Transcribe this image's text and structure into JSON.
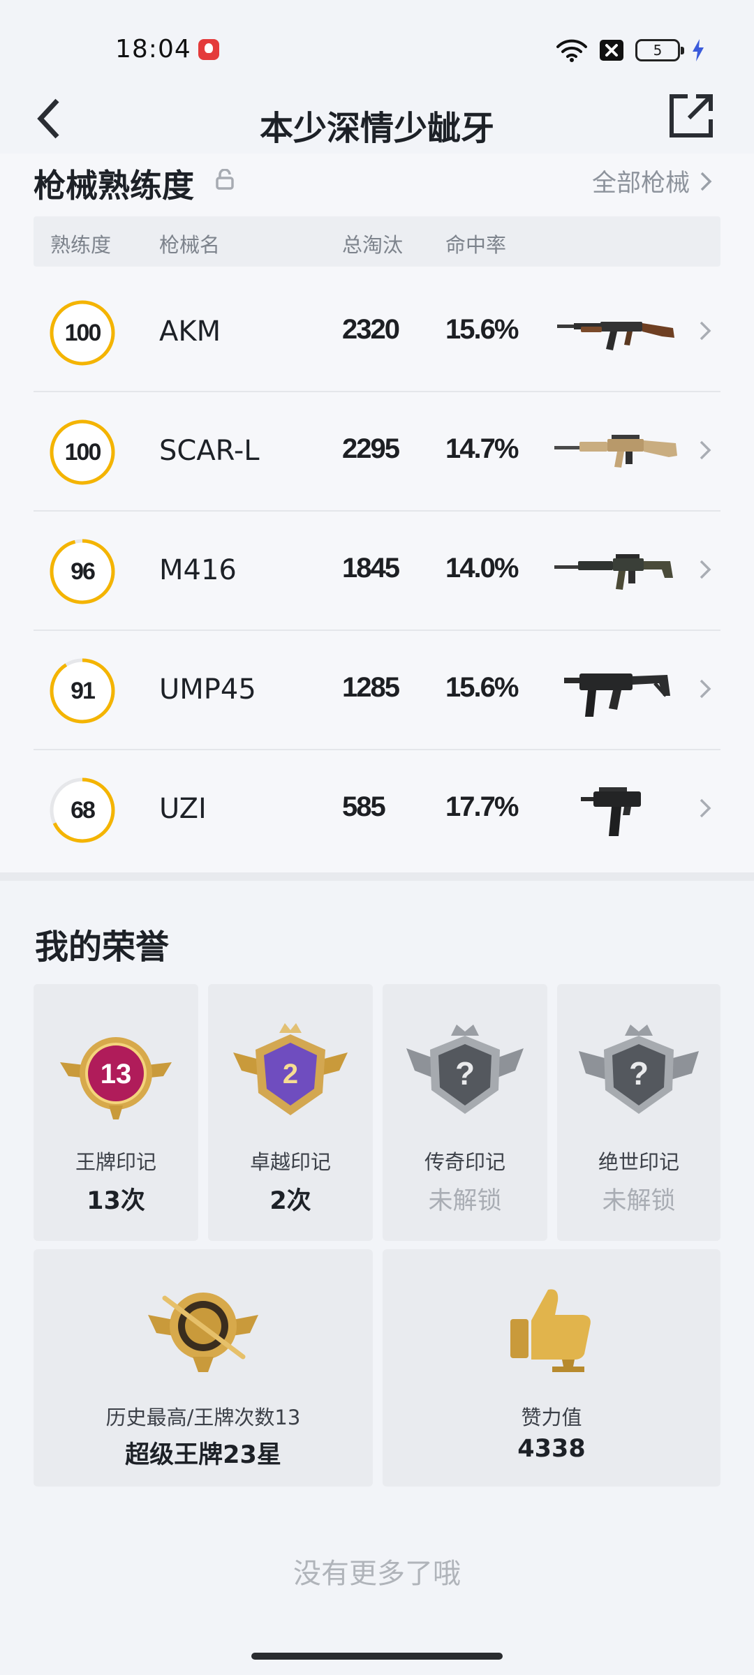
{
  "status_bar": {
    "time": "18:04",
    "battery_level": "5",
    "icons": [
      "app-badge-icon",
      "wifi-icon",
      "notification-x-icon",
      "battery-icon",
      "charging-bolt-icon"
    ]
  },
  "header": {
    "title": "本少深情少龇牙",
    "back_icon": "chevron-left-icon",
    "share_icon": "share-external-icon"
  },
  "weapon_section": {
    "title": "枪械熟练度",
    "all_link": "全部枪械",
    "columns": [
      "熟练度",
      "枪械名",
      "总淘汰",
      "命中率"
    ],
    "ring_color": "#f4b400",
    "weapons": [
      {
        "proficiency": "100",
        "progress": 1.0,
        "name": "AKM",
        "kills": "2320",
        "hit_rate": "15.6%",
        "icon": "akm-rifle-icon"
      },
      {
        "proficiency": "100",
        "progress": 1.0,
        "name": "SCAR-L",
        "kills": "2295",
        "hit_rate": "14.7%",
        "icon": "scar-l-rifle-icon"
      },
      {
        "proficiency": "96",
        "progress": 0.96,
        "name": "M416",
        "kills": "1845",
        "hit_rate": "14.0%",
        "icon": "m416-rifle-icon"
      },
      {
        "proficiency": "91",
        "progress": 0.91,
        "name": "UMP45",
        "kills": "1285",
        "hit_rate": "15.6%",
        "icon": "ump45-smg-icon"
      },
      {
        "proficiency": "68",
        "progress": 0.68,
        "name": "UZI",
        "kills": "585",
        "hit_rate": "17.7%",
        "icon": "uzi-smg-icon"
      }
    ]
  },
  "honor_section": {
    "title": "我的荣誉",
    "marks": [
      {
        "name": "王牌印记",
        "value": "13次",
        "badge_number": "13",
        "locked": false,
        "icon": "ace-mark-badge-icon"
      },
      {
        "name": "卓越印记",
        "value": "2次",
        "badge_number": "2",
        "locked": false,
        "icon": "excellence-mark-badge-icon"
      },
      {
        "name": "传奇印记",
        "value": "未解锁",
        "badge_number": "?",
        "locked": true,
        "icon": "legend-mark-badge-icon"
      },
      {
        "name": "绝世印记",
        "value": "未解锁",
        "badge_number": "?",
        "locked": true,
        "icon": "peerless-mark-badge-icon"
      }
    ],
    "records": [
      {
        "name": "历史最高/王牌次数13",
        "value": "超级王牌23星",
        "icon": "highest-rank-emblem-icon"
      },
      {
        "name": "赞力值",
        "value": "4338",
        "icon": "thumbs-up-trophy-icon"
      }
    ]
  },
  "footer": {
    "no_more": "没有更多了哦"
  }
}
